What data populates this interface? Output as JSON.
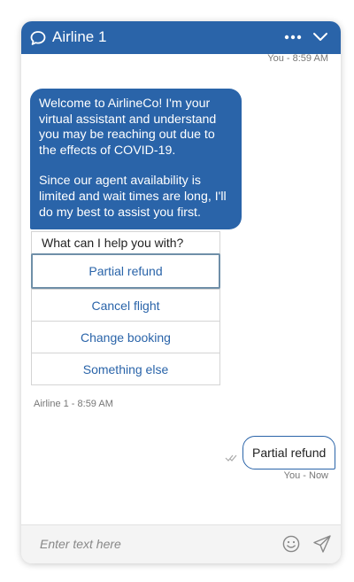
{
  "header": {
    "title": "Airline 1",
    "icons": {
      "chat": "chat-bubble-icon",
      "more": "more-horizontal-icon",
      "minimize": "chevron-down-icon"
    },
    "color": "#2a64a9"
  },
  "messages": {
    "top_meta": "You - 8:59 AM",
    "bot_paragraph_1": "Welcome to AirlineCo! I'm your virtual assistant and understand you may be reaching out due to the effects of COVID-19.",
    "bot_paragraph_2": "Since our agent availability is limited and wait times are long, I'll do my best to assist you first.",
    "quick_replies": {
      "prompt": "What can I help you with?",
      "options": [
        {
          "label": "Partial refund",
          "selected": true
        },
        {
          "label": "Cancel flight",
          "selected": false
        },
        {
          "label": "Change booking",
          "selected": false
        },
        {
          "label": "Something else",
          "selected": false
        }
      ]
    },
    "bot_meta": "Airline 1 - 8:59 AM",
    "user_message": "Partial refund",
    "user_meta": "You - Now"
  },
  "footer": {
    "placeholder": "Enter text here",
    "icons": {
      "emoji": "smiley-icon",
      "send": "send-icon"
    }
  }
}
